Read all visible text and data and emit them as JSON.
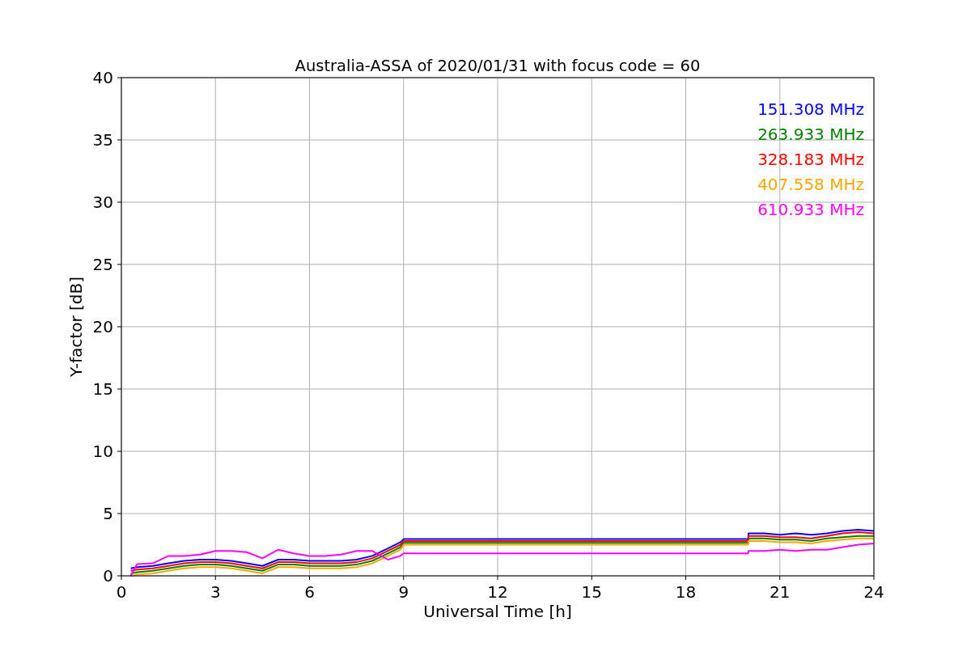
{
  "chart": {
    "chart_data": {
      "type": "line",
      "title": "Australia-ASSA of 2020/01/31 with focus code = 60",
      "xlabel": "Universal Time [h]",
      "ylabel": "Y-factor [dB]",
      "x": [
        0.3,
        0.5,
        1,
        1.5,
        2,
        2.5,
        3,
        3.5,
        4,
        4.5,
        5,
        5.5,
        6,
        6.5,
        7,
        7.5,
        8,
        8.5,
        8.9,
        9,
        19.99,
        20,
        20.5,
        21,
        21.5,
        22,
        22.5,
        23,
        23.5,
        24
      ],
      "series": [
        {
          "name": "151.308 MHz",
          "color": "#0000ff",
          "values": [
            0.6,
            0.7,
            0.8,
            1.0,
            1.2,
            1.3,
            1.3,
            1.2,
            1.0,
            0.8,
            1.3,
            1.3,
            1.2,
            1.2,
            1.2,
            1.3,
            1.6,
            2.2,
            2.7,
            2.95,
            2.95,
            3.4,
            3.4,
            3.3,
            3.4,
            3.3,
            3.4,
            3.6,
            3.7,
            3.6
          ]
        },
        {
          "name": "263.933 MHz",
          "color": "#008000",
          "values": [
            0.2,
            0.3,
            0.4,
            0.6,
            0.8,
            0.9,
            0.9,
            0.8,
            0.6,
            0.4,
            0.9,
            0.9,
            0.8,
            0.8,
            0.8,
            0.9,
            1.2,
            1.8,
            2.3,
            2.65,
            2.65,
            3.0,
            3.0,
            2.9,
            2.9,
            2.8,
            3.0,
            3.1,
            3.2,
            3.2
          ]
        },
        {
          "name": "328.183 MHz",
          "color": "#ff0000",
          "values": [
            0.4,
            0.5,
            0.6,
            0.8,
            1.0,
            1.1,
            1.1,
            1.0,
            0.8,
            0.6,
            1.1,
            1.1,
            1.0,
            1.0,
            1.0,
            1.1,
            1.4,
            2.0,
            2.5,
            2.8,
            2.8,
            3.2,
            3.2,
            3.1,
            3.1,
            3.0,
            3.2,
            3.4,
            3.5,
            3.4
          ]
        },
        {
          "name": "407.558 MHz",
          "color": "#ffa500",
          "values": [
            0,
            0.1,
            0.2,
            0.4,
            0.6,
            0.7,
            0.7,
            0.6,
            0.4,
            0.2,
            0.7,
            0.7,
            0.6,
            0.6,
            0.6,
            0.7,
            1.0,
            1.6,
            2.1,
            2.5,
            2.5,
            2.8,
            2.8,
            2.7,
            2.7,
            2.6,
            2.8,
            2.9,
            3.0,
            3.0
          ]
        },
        {
          "name": "610.933 MHz",
          "color": "#ff00ff",
          "values": [
            0,
            0.95,
            1.0,
            1.6,
            1.6,
            1.7,
            2.0,
            2.0,
            1.9,
            1.4,
            2.1,
            1.8,
            1.6,
            1.6,
            1.7,
            2.0,
            2.0,
            1.3,
            1.6,
            1.8,
            1.8,
            2.0,
            2.0,
            2.1,
            2.0,
            2.1,
            2.1,
            2.3,
            2.5,
            2.6
          ]
        }
      ],
      "grid": true,
      "xlim": [
        0,
        24
      ],
      "ylim": [
        0,
        40
      ],
      "xticks": [
        0,
        3,
        6,
        9,
        12,
        15,
        18,
        21,
        24
      ],
      "yticks": [
        0,
        5,
        10,
        15,
        20,
        25,
        30,
        35,
        40
      ]
    }
  }
}
